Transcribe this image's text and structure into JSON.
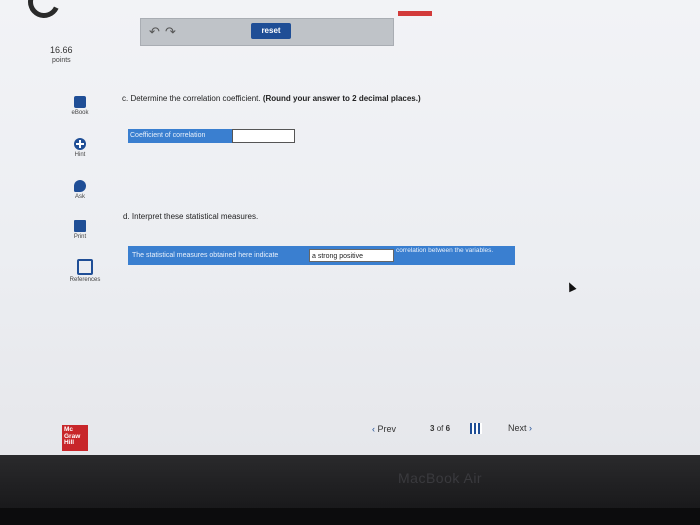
{
  "toolbar": {
    "reset_label": "reset"
  },
  "score": {
    "value": "16.66",
    "label": "points"
  },
  "sidebar": {
    "items": [
      {
        "label": "eBook",
        "icon": "ebook-icon"
      },
      {
        "label": "Hint",
        "icon": "hint-icon"
      },
      {
        "label": "Ask",
        "icon": "ask-icon"
      },
      {
        "label": "Print",
        "icon": "print-icon"
      },
      {
        "label": "References",
        "icon": "references-icon"
      }
    ]
  },
  "question_c": {
    "prefix": "c. Determine the correlation coefficient.",
    "instruction": "(Round your answer to 2 decimal places.)",
    "field_label": "Coefficient of correlation",
    "field_value": ""
  },
  "question_d": {
    "prefix": "d. Interpret these statistical measures.",
    "sentence_start": "The statistical measures obtained here indicate",
    "selected_option": "a strong positive",
    "sentence_end": "correlation between the variables."
  },
  "nav": {
    "prev_label": "Prev",
    "page_current": "3",
    "page_of": "of",
    "page_total": "6",
    "next_label": "Next"
  },
  "brand": {
    "logo_text": "Mc Graw Hill"
  },
  "device": {
    "label": "MacBook Air"
  },
  "colors": {
    "accent": "#1f4e96",
    "field": "#3a7fd0",
    "alert": "#d23a3a"
  }
}
